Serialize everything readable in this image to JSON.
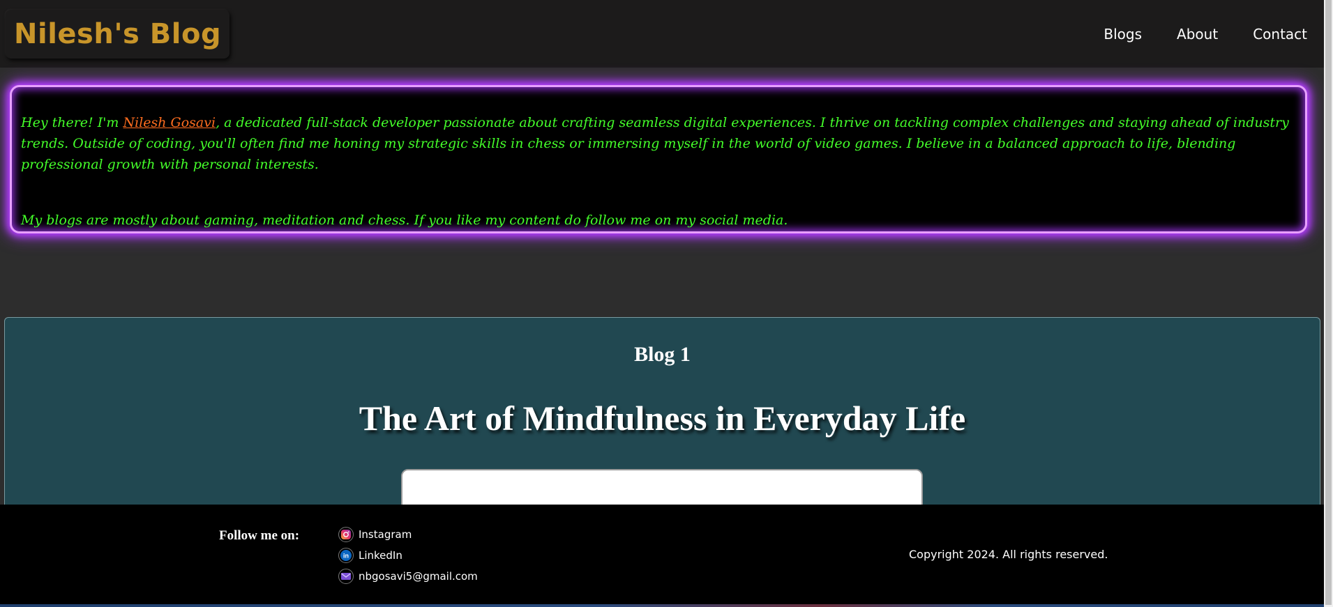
{
  "header": {
    "logo": "Nilesh's Blog",
    "nav": [
      "Blogs",
      "About",
      "Contact"
    ]
  },
  "intro": {
    "greeting": "Hey there! I'm ",
    "name": "Nilesh Gosavi",
    "rest": ", a dedicated full-stack developer passionate about crafting seamless digital experiences. I thrive on tackling complex challenges and staying ahead of industry trends. Outside of coding, you'll often find me honing my strategic skills in chess or immersing myself in the world of video games. I believe in a balanced approach to life, blending professional growth with personal interests.",
    "second": "My blogs are mostly about gaming, meditation and chess. If you like my content do follow me on my social media."
  },
  "blog": {
    "label": "Blog 1",
    "title": "The Art of Mindfulness in Everyday Life"
  },
  "footer": {
    "follow_label": "Follow me on:",
    "socials": [
      {
        "label": "Instagram",
        "icon": "instagram-icon"
      },
      {
        "label": "LinkedIn",
        "icon": "linkedin-icon"
      },
      {
        "label": "nbgosavi5@gmail.com",
        "icon": "mail-icon"
      }
    ],
    "copyright": "Copyright 2024. All rights reserved."
  },
  "colors": {
    "header_bg": "#1c1b1b",
    "logo": "#c8952a",
    "neon_border": "#b23cff",
    "intro_text": "#44ff2a",
    "name_link": "#ff6d1f",
    "blog_card_bg": "#214851",
    "footer_bg": "#000000"
  }
}
